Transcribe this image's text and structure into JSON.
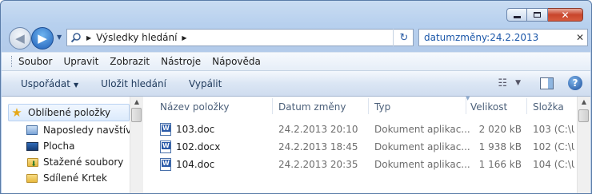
{
  "nav": {
    "address_segment": "Výsledky hledání",
    "search_value": "datumzměny:24.2.2013"
  },
  "menu": [
    "Soubor",
    "Upravit",
    "Zobrazit",
    "Nástroje",
    "Nápověda"
  ],
  "commands": {
    "organize": "Uspořádat",
    "save_search": "Uložit hledání",
    "burn": "Vypálit"
  },
  "sidebar": {
    "favorites": "Oblíbené položky",
    "items": [
      {
        "label": "Naposledy navštíve",
        "icon": "recent-places-icon"
      },
      {
        "label": "Plocha",
        "icon": "desktop-icon"
      },
      {
        "label": "Stažené soubory",
        "icon": "downloads-folder-icon"
      },
      {
        "label": "Sdílené Krtek",
        "icon": "folder-icon"
      }
    ]
  },
  "columns": {
    "name": "Název položky",
    "date": "Datum změny",
    "type": "Typ",
    "size": "Velikost",
    "folder": "Složka"
  },
  "files": [
    {
      "name": "103.doc",
      "date": "24.2.2013 20:10",
      "type": "Dokument aplikac...",
      "size": "2 020 kB",
      "folder": "103 (C:\\U"
    },
    {
      "name": "102.docx",
      "date": "24.2.2013 18:45",
      "type": "Dokument aplikac...",
      "size": "1 938 kB",
      "folder": "102 (C:\\U"
    },
    {
      "name": "104.doc",
      "date": "24.2.2013 20:35",
      "type": "Dokument aplikac...",
      "size": "1 166 kB",
      "folder": "104 (C:\\U"
    }
  ]
}
